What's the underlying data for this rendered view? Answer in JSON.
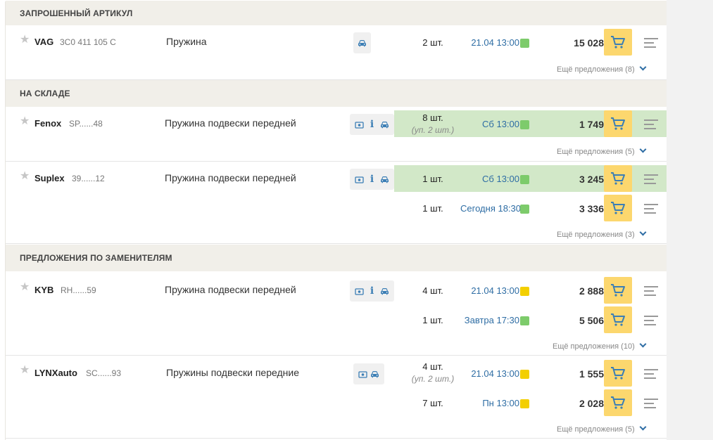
{
  "sections": {
    "requested": {
      "title": "ЗАПРОШЕННЫЙ АРТИКУЛ"
    },
    "stock": {
      "title": "НА СКЛАДЕ"
    },
    "replacements": {
      "title": "ПРЕДЛОЖЕНИЯ ПО ЗАМЕНИТЕЛЯМ"
    }
  },
  "items": [
    {
      "brand": "VAG",
      "code": "3C0 411 105 C",
      "description": "Пружина",
      "icons": [
        "car-icon"
      ],
      "offers": [
        {
          "qty": "2 шт.",
          "date": "21.04 13:00",
          "status": "green",
          "price": "15 028",
          "highlight": false
        }
      ],
      "more": "Ещё предложения (8)"
    },
    {
      "brand": "Fenox",
      "code": "SP......48",
      "description": "Пружина подвески передней",
      "icons": [
        "photo-icon",
        "info-icon",
        "car-icon"
      ],
      "offers": [
        {
          "qty": "8 шт.",
          "qty_note": "(уп. 2 шт.)",
          "date": "Сб 13:00",
          "status": "green",
          "price": "1 749",
          "highlight": true
        }
      ],
      "more": "Ещё предложения (5)"
    },
    {
      "brand": "Suplex",
      "code": "39......12",
      "description": "Пружина подвески передней",
      "icons": [
        "photo-icon",
        "info-icon",
        "car-icon"
      ],
      "offers": [
        {
          "qty": "1 шт.",
          "date": "Сб 13:00",
          "status": "green",
          "price": "3 245",
          "highlight": true
        },
        {
          "qty": "1 шт.",
          "date": "Сегодня 18:30",
          "status": "green",
          "price": "3 336",
          "highlight": false
        }
      ],
      "more": "Ещё предложения (3)"
    },
    {
      "brand": "KYB",
      "code": "RH......59",
      "description": "Пружина подвески передней",
      "icons": [
        "photo-icon",
        "info-icon",
        "car-icon"
      ],
      "offers": [
        {
          "qty": "4 шт.",
          "date": "21.04 13:00",
          "status": "yellow",
          "price": "2 888",
          "highlight": false
        },
        {
          "qty": "1 шт.",
          "date": "Завтра 17:30",
          "status": "green",
          "price": "5 506",
          "highlight": false
        }
      ],
      "more": "Ещё предложения (10)"
    },
    {
      "brand": "LYNXauto",
      "code": "SC......93",
      "description": "Пружины подвески передние",
      "icons": [
        "photo-icon",
        "car-icon"
      ],
      "offers": [
        {
          "qty": "4 шт.",
          "qty_note": "(уп. 2 шт.)",
          "date": "21.04 13:00",
          "status": "yellow",
          "price": "1 555",
          "highlight": false
        },
        {
          "qty": "7 шт.",
          "date": "Пн 13:00",
          "status": "yellow",
          "price": "2 028",
          "highlight": false
        }
      ],
      "more": "Ещё предложения (5)"
    }
  ],
  "colors": {
    "section_bg": "#f1efe9",
    "highlight_bg": "#d2e8c8",
    "cart_bg": "#fcd76e",
    "link": "#2e6da4",
    "status_green": "#7dcb6b",
    "status_yellow": "#f3cf00"
  }
}
